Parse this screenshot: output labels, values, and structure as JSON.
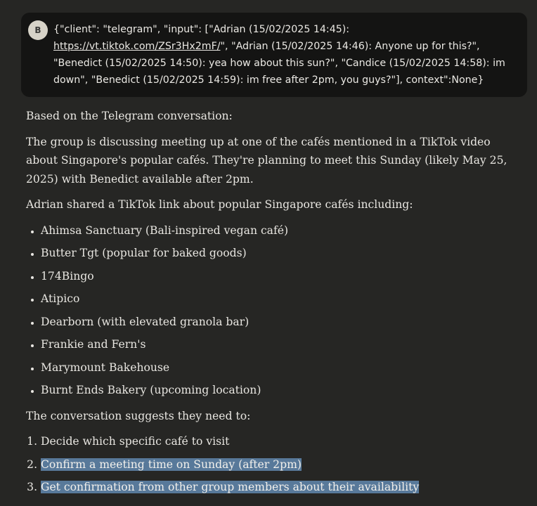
{
  "user_message": {
    "avatar_initial": "B",
    "text_before_link": "{\"client\": \"telegram\", \"input\": [\"Adrian (15/02/2025 14:45): ",
    "link_text": "https://vt.tiktok.com/ZSr3Hx2mF/",
    "text_after_link": "\", \"Adrian (15/02/2025 14:46): Anyone up for this?\", \"Benedict (15/02/2025 14:50): yea how about this sun?\", \"Candice (15/02/2025 14:58): im down\", \"Benedict (15/02/2025 14:59): im free after 2pm, you guys?\"], context\":None}"
  },
  "response": {
    "intro": "Based on the Telegram conversation:",
    "summary": "The group is discussing meeting up at one of the cafés mentioned in a TikTok video about Singapore's popular cafés. They're planning to meet this Sunday (likely May 25, 2025) with Benedict available after 2pm.",
    "link_intro": "Adrian shared a TikTok link about popular Singapore cafés including:",
    "cafes": [
      "Ahimsa Sanctuary (Bali-inspired vegan café)",
      "Butter Tgt (popular for baked goods)",
      "174Bingo",
      "Atipico",
      "Dearborn (with elevated granola bar)",
      "Frankie and Fern's",
      "Marymount Bakehouse",
      "Burnt Ends Bakery (upcoming location)"
    ],
    "needs_intro": "The conversation suggests they need to:",
    "steps": [
      "Decide which specific café to visit",
      "Confirm a meeting time on Sunday (after 2pm)",
      "Get confirmation from other group members about their availability"
    ]
  },
  "colors": {
    "background": "#262624",
    "user_bubble": "#141413",
    "selection_highlight": "#58799a"
  }
}
